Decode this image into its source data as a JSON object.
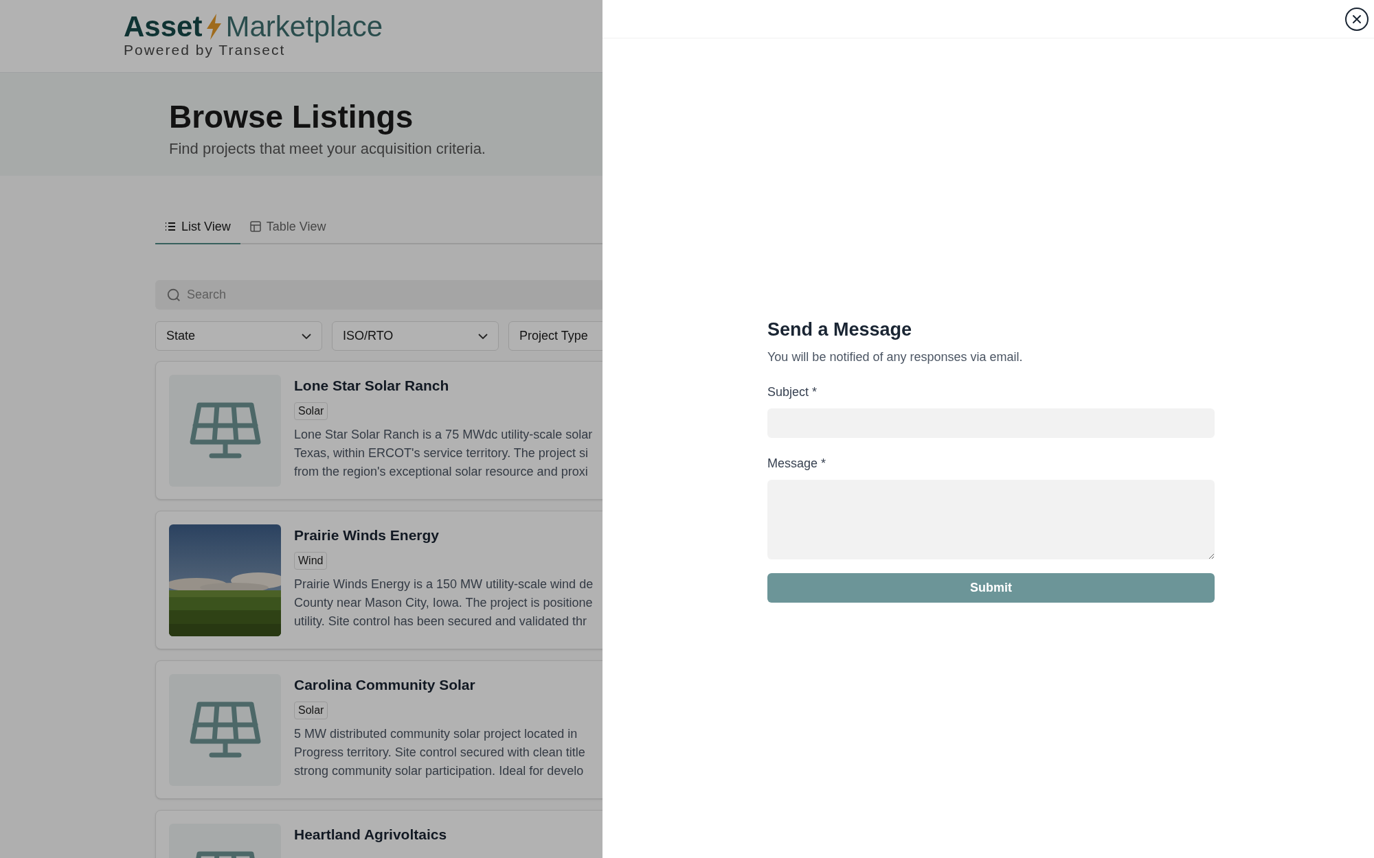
{
  "header": {
    "brand_bold": "Asset",
    "brand_light": "Marketplace",
    "tagline": "Powered by Transect"
  },
  "hero": {
    "title": "Browse Listings",
    "subtitle": "Find projects that meet your acquisition criteria."
  },
  "tabs": [
    {
      "label": "List View",
      "kind": "list",
      "selected": true
    },
    {
      "label": "Table View",
      "kind": "table",
      "selected": false
    }
  ],
  "search": {
    "placeholder": "Search"
  },
  "filters": [
    {
      "label": "State"
    },
    {
      "label": "ISO/RTO"
    },
    {
      "label": "Project Type"
    }
  ],
  "listings": [
    {
      "title": "Lone Star Solar Ranch",
      "tag": "Solar",
      "kind": "icon",
      "description_lines": [
        "Lone Star Solar Ranch is a 75 MWdc utility-scale solar",
        "Texas, within ERCOT's service territory. The project si",
        "from the region's exceptional solar resource and proxi"
      ]
    },
    {
      "title": "Prairie Winds Energy",
      "tag": "Wind",
      "kind": "picture",
      "description_lines": [
        "Prairie Winds Energy is a 150 MW utility-scale wind de",
        "County near Mason City, Iowa. The project is positione",
        "utility. Site control has been secured and validated thr"
      ]
    },
    {
      "title": "Carolina Community Solar",
      "tag": "Solar",
      "kind": "icon",
      "description_lines": [
        "5 MW distributed community solar project located in",
        "Progress territory. Site control secured with clean title",
        "strong community solar participation. Ideal for develo"
      ]
    },
    {
      "title": "Heartland Agrivoltaics",
      "kind": "icon"
    }
  ],
  "drawer": {
    "title": "Send a Message",
    "subtitle": "You will be notified of any responses via email.",
    "fields": [
      {
        "label": "Subject *",
        "kind": "input"
      },
      {
        "label": "Message *",
        "kind": "textarea"
      }
    ],
    "submit": "Submit"
  }
}
